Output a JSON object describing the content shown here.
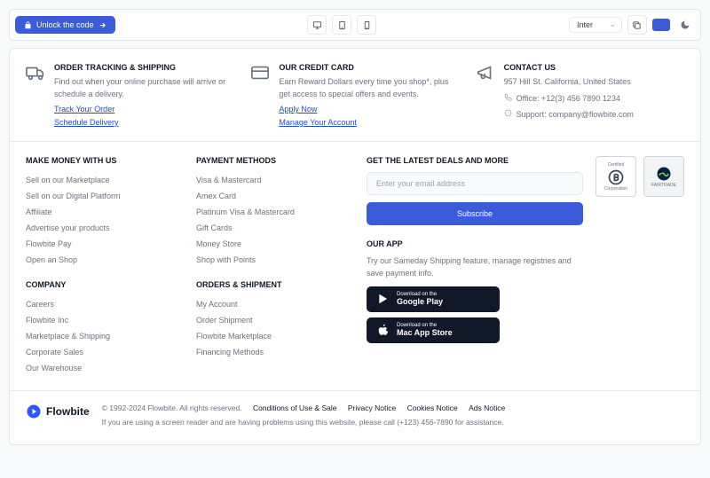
{
  "topbar": {
    "unlock": "Unlock the code",
    "select": "Inter"
  },
  "t3": [
    {
      "h": "ORDER TRACKING & SHIPPING",
      "d": "Find out when your online purchase will arrive or schedule a delivery.",
      "links": [
        "Track Your Order",
        "Schedule Delivery"
      ]
    },
    {
      "h": "OUR CREDIT CARD",
      "d": "Earn Reward Dollars every time you shop*, plus get access to special offers and events.",
      "links": [
        "Apply Now",
        "Manage Your Account"
      ]
    },
    {
      "h": "CONTACT US",
      "addr": "957 Hill St. California, United States",
      "office": "Office: +12(3) 456 7890 1234",
      "support": "Support:  company@flowbite.com"
    }
  ],
  "cols": [
    {
      "h": "MAKE MONEY WITH US",
      "items": [
        "Sell on our Marketplace",
        "Sell on our Digital Platform",
        "Affiliate",
        "Advertise your products",
        "Flowbite Pay",
        "Open an Shop"
      ]
    },
    {
      "h": "PAYMENT METHODS",
      "items": [
        "Visa & Mastercard",
        "Amex Card",
        "Platinum Visa & Mastercard",
        "Gift Cards",
        "Money Store",
        "Shop with Points"
      ]
    },
    {
      "h": "COMPANY",
      "items": [
        "Careers",
        "Flowbite Inc",
        "Marketplace & Shipping",
        "Corporate Sales",
        "Our Warehouse"
      ]
    },
    {
      "h": "ORDERS & SHIPMENT",
      "items": [
        "My Account",
        "Order Shipment",
        "Flowbite Marketplace",
        "Financing Methods"
      ]
    }
  ],
  "newsletter": {
    "h": "GET THE LATEST DEALS AND MORE",
    "ph": "Enter your email address",
    "btn": "Subscribe"
  },
  "app": {
    "h": "OUR APP",
    "d": "Try our Sameday Shipping feature, manage registries and save payment info.",
    "s1": {
      "a": "Download on the",
      "b": "Google Play"
    },
    "s2": {
      "a": "Download on the",
      "b": "Mac App Store"
    }
  },
  "badges": {
    "b1": "Corporation",
    "b2": "FAIRTRADE",
    "cert": "Certified"
  },
  "brand": "Flowbite",
  "foot": {
    "c": "© 1992-2024 Flowbite. All rights reserved.",
    "links": [
      "Conditions of Use & Sale",
      "Privacy Notice",
      "Cookies Notice",
      "Ads Notice"
    ],
    "a11y": "If you are using a screen reader and are having problems using this website, please call (+123) 456-7890 for assistance."
  }
}
